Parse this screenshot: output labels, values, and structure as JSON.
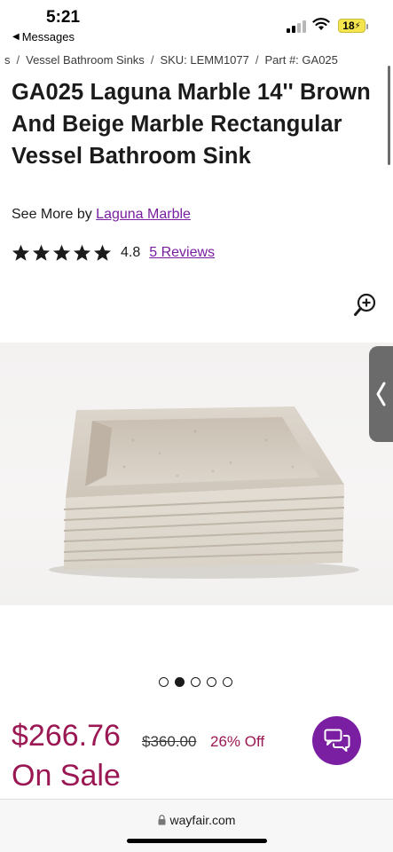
{
  "status_bar": {
    "time": "5:21",
    "back_label": "Messages",
    "battery": "18"
  },
  "breadcrumb": {
    "items": [
      "s",
      "Vessel Bathroom Sinks",
      "SKU: LEMM1077",
      "Part #: GA025"
    ]
  },
  "product": {
    "title": "GA025 Laguna Marble 14'' Brown And Beige Marble Rectangular Vessel Bathroom Sink",
    "see_more_prefix": "See More by",
    "brand": "Laguna Marble",
    "rating": "4.8",
    "stars": 5,
    "reviews_label": "5 Reviews"
  },
  "carousel": {
    "dot_count": 5,
    "active_index": 1
  },
  "pricing": {
    "sale_price": "$266.76",
    "original_price": "$360.00",
    "discount": "26% Off",
    "on_sale_label": "On Sale"
  },
  "browser": {
    "url": "wayfair.com"
  },
  "colors": {
    "accent_purple": "#7b1fa2",
    "price_red": "#9b1753",
    "link_purple": "#7a1ea1"
  },
  "icons": {
    "zoom": "zoom-in-icon",
    "chat": "chat-icon",
    "prev": "chevron-left-icon",
    "lock": "lock-icon"
  }
}
